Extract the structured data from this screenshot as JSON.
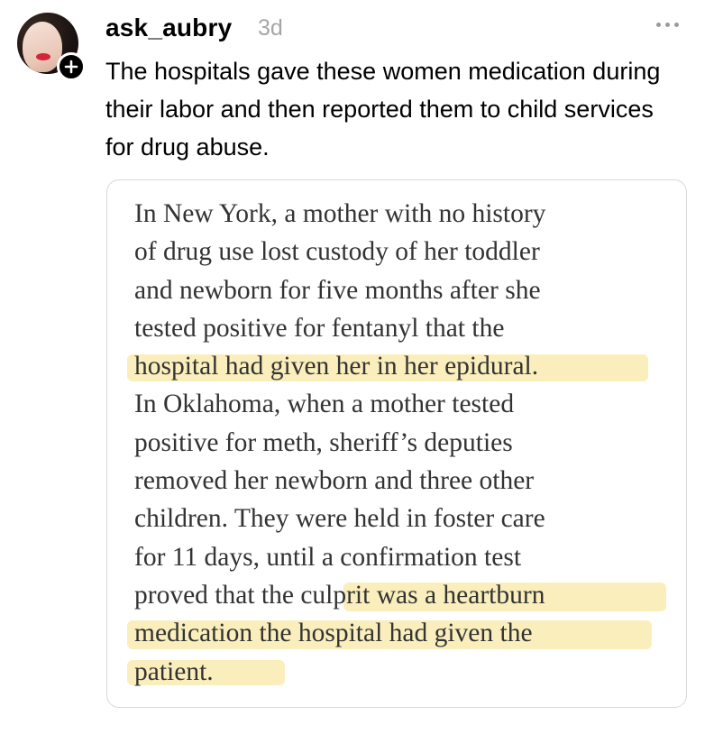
{
  "post": {
    "username": "ask_aubry",
    "time": "3d",
    "caption": "The hospitals gave these women medication during their labor and then reported them to child services for drug abuse."
  },
  "quote": {
    "lines": [
      "In New York, a mother with no history",
      "of drug use lost custody of her toddler",
      "and newborn for five months after she",
      "tested positive for fentanyl that the",
      "hospital had given her in her epidural.",
      "In Oklahoma, when a mother tested",
      "positive for meth, sheriff’s deputies",
      "removed her newborn and three other",
      "children. They were held in foster care",
      "for 11 days, until a confirmation test",
      "proved that the culprit was a heartburn",
      "medication the hospital had given the",
      "patient."
    ]
  },
  "icons": {
    "avatar": "profile-photo",
    "follow": "plus-icon",
    "menu": "more-options-icon"
  },
  "colors": {
    "highlight": "#f9ecb0",
    "timestamp": "#a6a6a6",
    "quote_text": "#333333"
  }
}
